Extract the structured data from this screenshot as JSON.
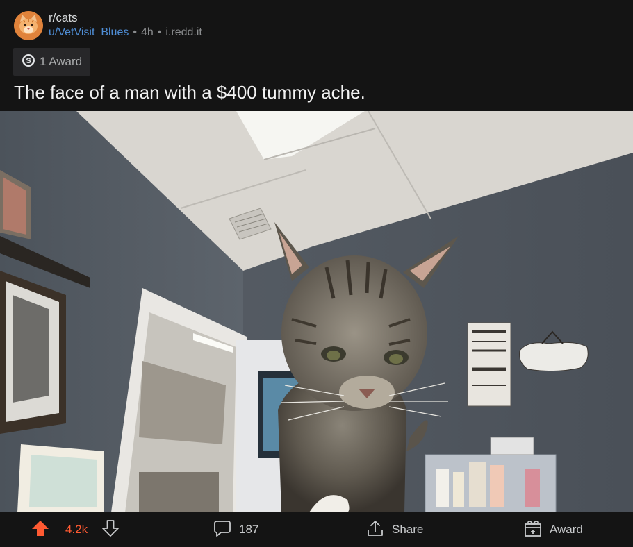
{
  "post": {
    "subreddit": "r/cats",
    "author": "u/VetVisit_Blues",
    "age": "4h",
    "domain": "i.redd.it",
    "awards_label": "1 Award",
    "title": "The face of a man with a $400 tummy ache."
  },
  "footer": {
    "score": "4.2k",
    "comments": "187",
    "share_label": "Share",
    "award_label": "Award"
  },
  "colors": {
    "background": "#141414",
    "upvote_active": "#ff5a32",
    "username_link": "#4f8ed6",
    "award_chip_bg": "#272729"
  },
  "icons": [
    "subreddit-avatar-icon",
    "silver-award-icon",
    "upvote-arrow-icon",
    "downvote-arrow-icon",
    "comment-bubble-icon",
    "share-icon",
    "award-gift-icon"
  ]
}
